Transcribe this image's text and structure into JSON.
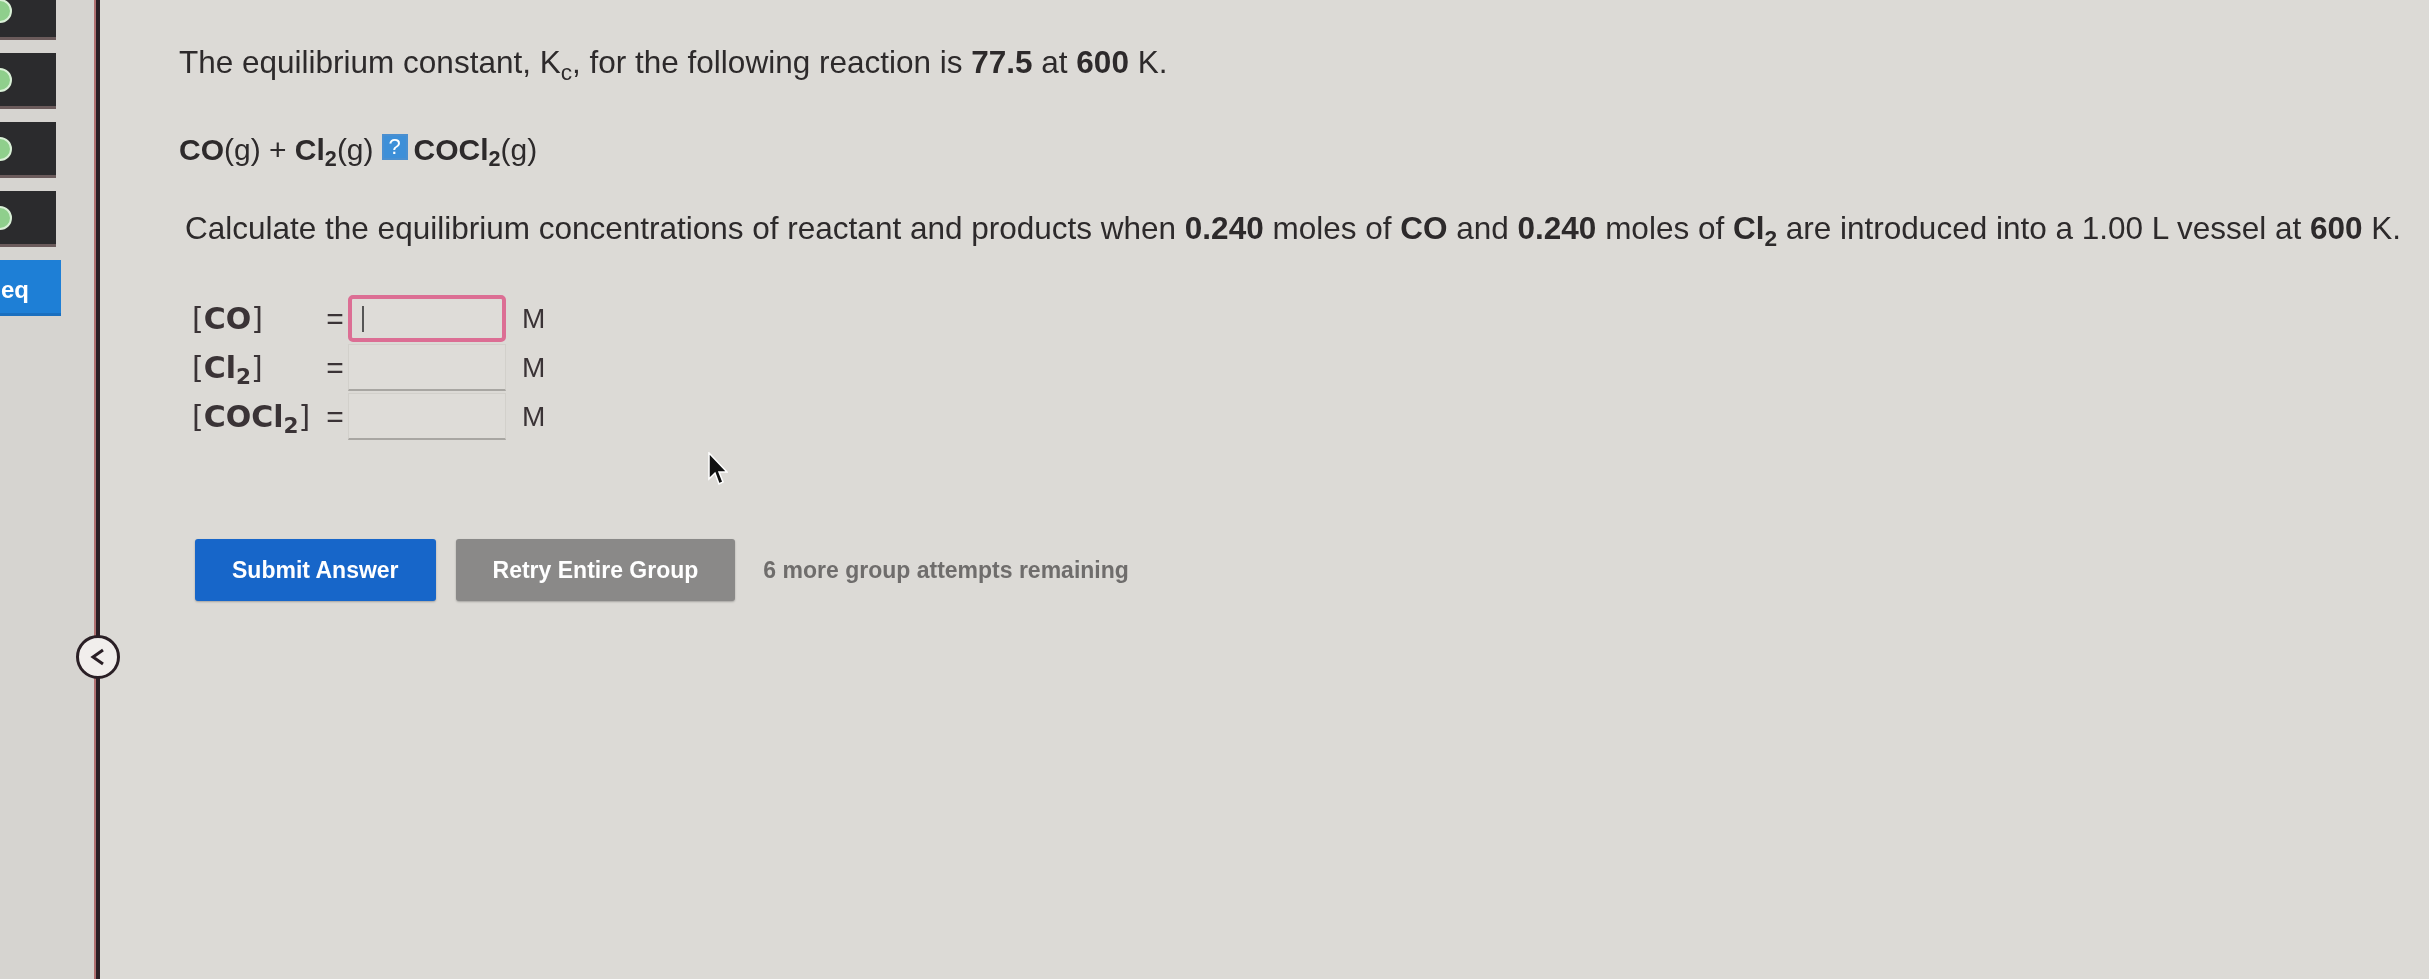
{
  "sidebar": {
    "items": [
      {
        "kind": "status",
        "selected": false
      },
      {
        "kind": "status",
        "selected": false
      },
      {
        "kind": "status",
        "selected": false
      },
      {
        "kind": "status",
        "selected": false
      },
      {
        "kind": "text",
        "label": "eq",
        "selected": true
      }
    ]
  },
  "question": {
    "intro": "The equilibrium constant, K$_{c}$, for the following reaction is **77.5** at **600** K.",
    "equation": {
      "reactants": "**CO**(g) + **Cl$_{2}$**(g)",
      "arrow_image": "?",
      "product": "**COCl$_{2}$**(g)"
    },
    "task": "Calculate the equilibrium concentrations of reactant and products when **0.240** moles of **CO** and **0.240** moles of **Cl$_{2}$** are introduced into a 1.00 L vessel at **600** K."
  },
  "answers": [
    {
      "label": "[**CO**]",
      "sign": "=",
      "unit": "M",
      "focused": true
    },
    {
      "label": "[**Cl$_{2}$**]",
      "sign": "=",
      "unit": "M",
      "focused": false
    },
    {
      "label": "[**COCl$_{2}$**]",
      "sign": "=",
      "unit": "M",
      "focused": false
    }
  ],
  "buttons": [
    {
      "label": "Submit Answer",
      "kind": "primary"
    },
    {
      "label": "Retry Entire Group",
      "kind": "secondary"
    }
  ],
  "attempts_note": "6 more group attempts remaining"
}
